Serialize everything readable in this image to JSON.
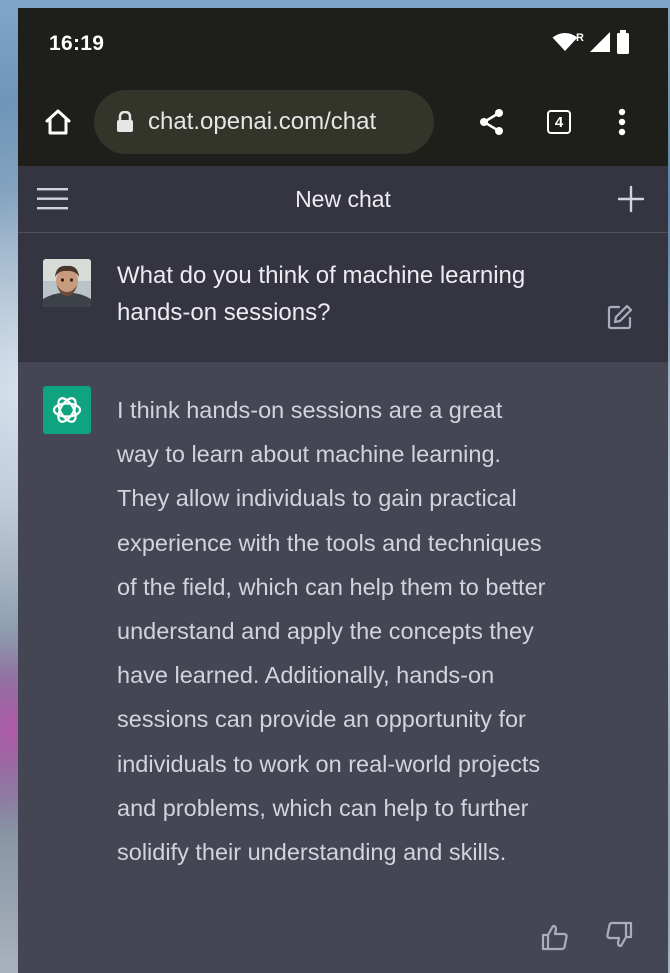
{
  "status_bar": {
    "time": "16:19",
    "roaming_indicator": "R",
    "icons": [
      "wifi-icon",
      "signal-icon",
      "battery-icon"
    ]
  },
  "browser": {
    "url": "chat.openai.com/chat",
    "tab_count": "4",
    "icons": [
      "home-icon",
      "lock-icon",
      "share-icon",
      "more-vertical-icon"
    ]
  },
  "chat_header": {
    "title": "New chat",
    "icons": [
      "hamburger-icon",
      "plus-icon"
    ]
  },
  "conversation": {
    "user_message": "What do you think of machine learning hands-on sessions?",
    "assistant_message": "I think hands-on sessions are a great way to learn about machine learning. They allow individuals to gain practical experience with the tools and techniques of the field, which can help them to better understand and apply the concepts they have learned. Additionally, hands-on sessions can provide an opportunity for individuals to work on real-world projects and problems, which can help to further solidify their understanding and skills.",
    "icons": [
      "avatar",
      "openai-logo-icon",
      "edit-icon",
      "thumbs-up-icon",
      "thumbs-down-icon"
    ]
  },
  "colors": {
    "browser_bar": "#1e1f1b",
    "url_pill": "#33352a",
    "chat_background": "#343541",
    "assistant_background": "#444654",
    "brand_green": "#10a37f",
    "text_primary": "#ececf1",
    "text_secondary": "#d1d5db"
  }
}
